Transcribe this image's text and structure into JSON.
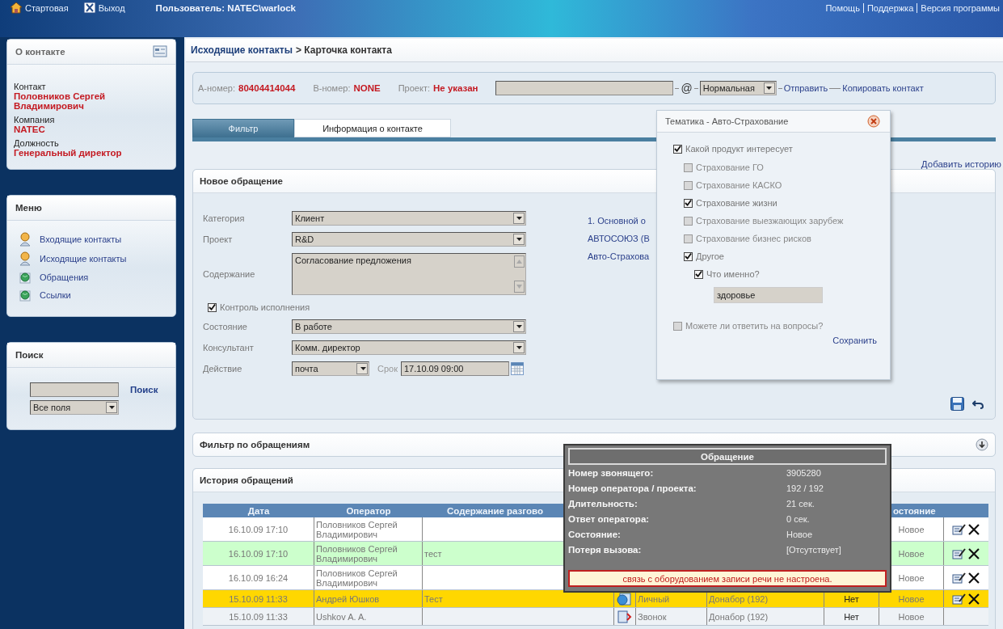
{
  "top_bar": {
    "links": [
      {
        "label": "Стартовая",
        "kind": "home"
      },
      {
        "label": "Выход",
        "kind": "exit"
      }
    ],
    "user": "Пользователь: NATEC\\warlock",
    "right_links": [
      "Помощь",
      "Поддержка",
      "Версия программы"
    ]
  },
  "contact_panel": {
    "title": "О контакте",
    "fields": [
      {
        "label": "Контакт",
        "value": "Половников Сергей Владимирович"
      },
      {
        "label": "Компания",
        "value": "NATEC"
      },
      {
        "label": "Должность",
        "value": "Генеральный директор"
      }
    ]
  },
  "menu": {
    "title": "Меню",
    "items": [
      {
        "label": "Входящие контакты",
        "kind": "contact"
      },
      {
        "label": "Исходящие контакты",
        "kind": "contact"
      },
      {
        "label": "Обращения",
        "kind": "globe"
      },
      {
        "label": "Ссылки",
        "kind": "globe"
      }
    ]
  },
  "search": {
    "title": "Поиск",
    "button": "Поиск",
    "scope": "Все поля"
  },
  "breadcrumb": {
    "parent": "Исходящие контакты",
    "current": "> Карточка контакта"
  },
  "info_bar": {
    "fields": [
      {
        "label": "А-номер:",
        "value": "80404414044"
      },
      {
        "label": "B-номер:",
        "value": "NONE"
      },
      {
        "label": "Проект:",
        "value": "Не указан"
      }
    ],
    "at_sign": "@",
    "priority": "Нормальная",
    "send": "Отправить",
    "copy": "Копировать контакт"
  },
  "tabs": [
    {
      "label": "Фильтр",
      "selected": true
    },
    {
      "label": "Информация о контакте",
      "selected": false
    }
  ],
  "add_history": "Добавить историю",
  "new_request": {
    "title": "Новое обращение",
    "fields": [
      {
        "kind": "select",
        "label": "Категория",
        "value": "Клиент"
      },
      {
        "kind": "select",
        "label": "Проект",
        "value": "R&D"
      },
      {
        "kind": "textarea",
        "label": "Содержание",
        "value": "Согласование предложения"
      },
      {
        "kind": "checkbox",
        "label": "Контроль исполнения",
        "checked": true
      },
      {
        "kind": "select",
        "label": "Состояние",
        "value": "В работе"
      },
      {
        "kind": "select",
        "label": "Консультант",
        "value": "Комм. директор"
      },
      {
        "kind": "action",
        "label": "Действие",
        "value": "почта",
        "due_label": "Срок",
        "due": "17.10.09 09:00"
      }
    ],
    "links": [
      "1. Основной о",
      "АВТОСОЮЗ (В",
      "Авто-Страхова"
    ]
  },
  "popup": {
    "title": "Тематика - Авто-Страхование",
    "items": [
      {
        "label": "Какой продукт интересует",
        "checked": true,
        "children": [
          {
            "label": "Страхование ГО",
            "checked": false
          },
          {
            "label": "Страхование КАСКО",
            "checked": false
          },
          {
            "label": "Страхование жизни",
            "checked": true
          },
          {
            "label": "Страхование выезжающих зарубеж",
            "checked": false
          },
          {
            "label": "Страхование бизнес рисков",
            "checked": false
          },
          {
            "label": "Другое",
            "checked": true,
            "children": [
              {
                "label": "Что именно?",
                "checked": true,
                "answer": "здоровье"
              }
            ]
          }
        ]
      },
      {
        "label": "Можете ли ответить на вопросы?",
        "checked": false
      }
    ],
    "save": "Сохранить"
  },
  "filter_panel": {
    "title": "Фильтр по обращениям"
  },
  "history": {
    "title": "История обращений",
    "columns": [
      {
        "kind": "date",
        "label": "Дата"
      },
      {
        "kind": "operator",
        "label": "Оператор"
      },
      {
        "kind": "content",
        "label": "Содержание разгово"
      },
      {
        "kind": "status",
        "label": "остояние"
      }
    ],
    "rows": [
      {
        "date": "16.10.09 17:10",
        "operator": "Половников Сергей Владимирович",
        "status": "Новое",
        "actions": true,
        "color": "#ffffff"
      },
      {
        "date": "16.10.09 17:10",
        "operator": "Половников Сергей Владимирович",
        "content": "тест",
        "status": "Новое",
        "actions": true,
        "color": "#ccffcc"
      },
      {
        "date": "16.10.09 16:24",
        "operator": "Половников Сергей Владимирович",
        "status": "Новое",
        "actions": true,
        "color": "#ffffff"
      },
      {
        "date": "15.10.09 11:33",
        "operator": "Андрей Юшков",
        "content": "Тест",
        "kind": "personal",
        "channel": "Личный",
        "project": "Донабор  (192)",
        "answered": "Нет",
        "status": "Новое",
        "actions": true,
        "color": "#ffd700"
      },
      {
        "date": "15.10.09 11:33",
        "operator": "Ushkov A. A.",
        "kind": "call",
        "channel": "Звонок",
        "project": "Донабор  (192)",
        "answered": "Нет",
        "status": "Новое",
        "actions": false,
        "color": "#eef2f6"
      }
    ]
  },
  "tooltip": {
    "title": "Обращение",
    "rows": [
      {
        "label": "Номер звонящего:",
        "value": "3905280"
      },
      {
        "label": "Номер оператора / проекта:",
        "value": "192 / 192"
      },
      {
        "label": "Длительность:",
        "value": "21 сек."
      },
      {
        "label": "Ответ оператора:",
        "value": "0 сек."
      },
      {
        "label": "Состояние:",
        "value": "Новое"
      },
      {
        "label": "Потеря вызова:",
        "value": "[Отсутствует]"
      }
    ],
    "warning": "связь с оборудованием записи речи не настроена."
  }
}
